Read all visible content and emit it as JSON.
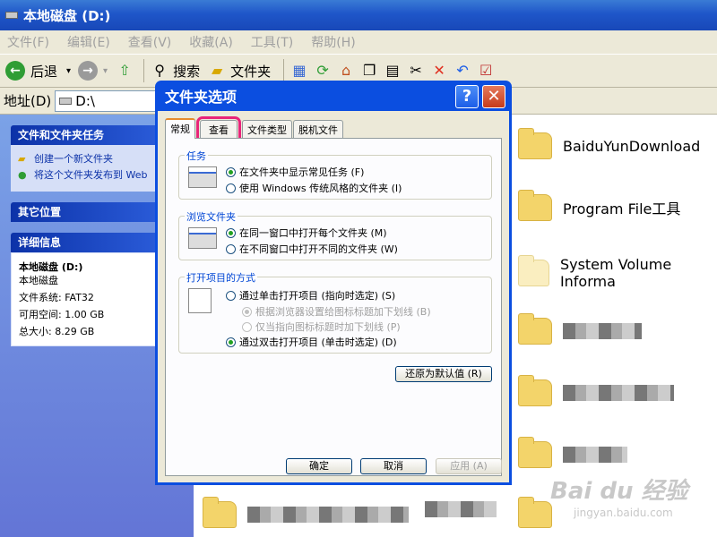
{
  "window": {
    "title": "本地磁盘 (D:)"
  },
  "menu": [
    "文件(F)",
    "编辑(E)",
    "查看(V)",
    "收藏(A)",
    "工具(T)",
    "帮助(H)"
  ],
  "toolbar": {
    "back": "后退",
    "search": "搜索",
    "folders": "文件夹"
  },
  "address": {
    "label": "地址(D)",
    "value": "D:\\"
  },
  "left": {
    "tasks_title": "文件和文件夹任务",
    "tasks": [
      "创建一个新文件夹",
      "将这个文件夹发布到 Web"
    ],
    "other_title": "其它位置",
    "details_title": "详细信息",
    "details": {
      "name": "本地磁盘 (D:)",
      "type": "本地磁盘",
      "fs": "文件系统: FAT32",
      "free": "可用空间: 1.00 GB",
      "total": "总大小: 8.29 GB"
    }
  },
  "files": [
    "BaiduYunDownload",
    "Program File工具",
    "System Volume Informa"
  ],
  "watermark": {
    "logo": "Bai du 经验",
    "url": "jingyan.baidu.com"
  },
  "dialog": {
    "title": "文件夹选项",
    "help": "?",
    "close": "✕",
    "tabs": [
      "常规",
      "查看",
      "文件类型",
      "脱机文件"
    ],
    "groups": {
      "tasks": {
        "label": "任务",
        "options": [
          "在文件夹中显示常见任务 (F)",
          "使用 Windows 传统风格的文件夹 (I)"
        ]
      },
      "browse": {
        "label": "浏览文件夹",
        "options": [
          "在同一窗口中打开每个文件夹 (M)",
          "在不同窗口中打开不同的文件夹 (W)"
        ]
      },
      "open": {
        "label": "打开项目的方式",
        "options": [
          "通过单击打开项目 (指向时选定) (S)",
          "根据浏览器设置给图标标题加下划线 (B)",
          "仅当指向图标标题时加下划线 (P)",
          "通过双击打开项目 (单击时选定) (D)"
        ]
      }
    },
    "restore": "还原为默认值 (R)",
    "ok": "确定",
    "cancel": "取消",
    "apply": "应用 (A)"
  }
}
